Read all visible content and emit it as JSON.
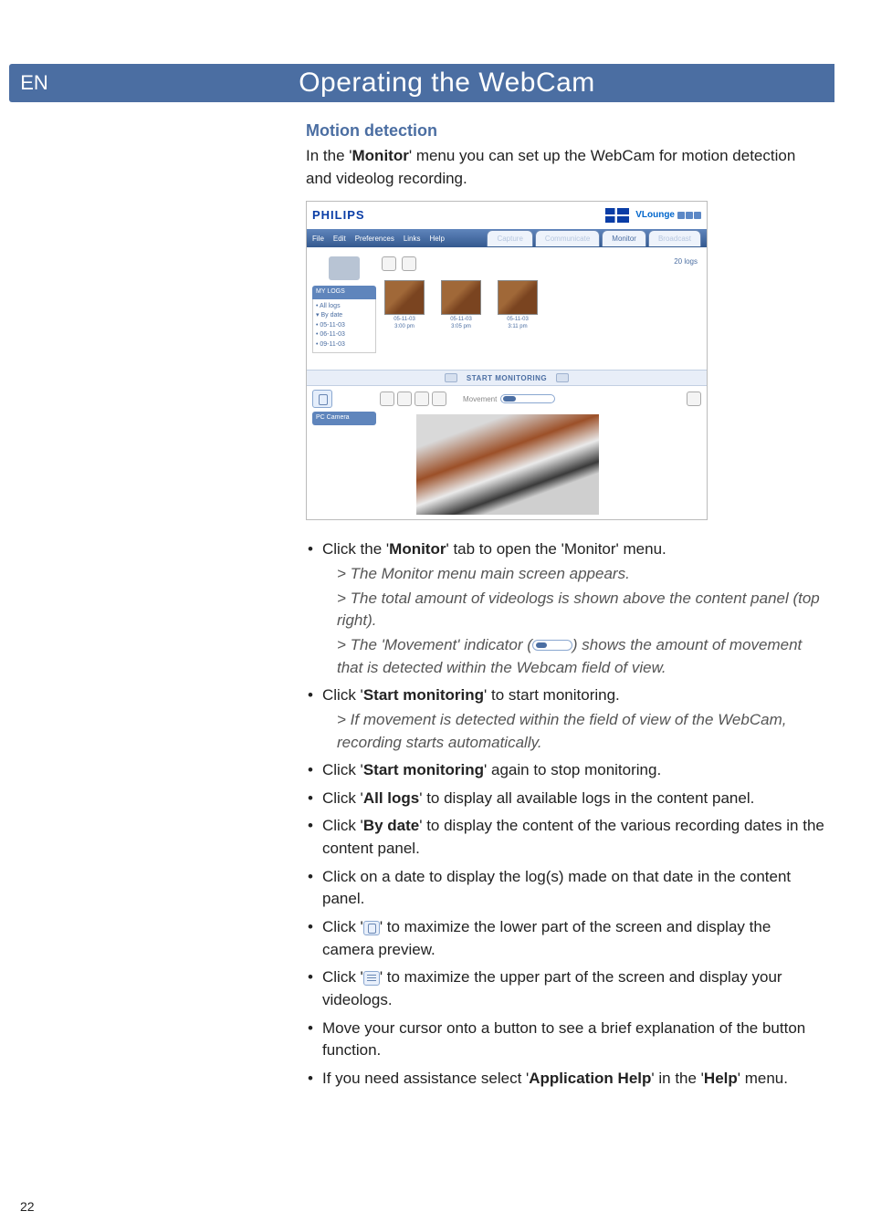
{
  "lang": "EN",
  "pageTitle": "Operating the WebCam",
  "h3": "Motion detection",
  "intro_pre": "In the '",
  "intro_bold": "Monitor",
  "intro_post": "' menu you can set up the WebCam for motion detection and videolog recording.",
  "screenshot": {
    "brand": "PHILIPS",
    "app": "VLounge",
    "menu": [
      "File",
      "Edit",
      "Preferences",
      "Links",
      "Help"
    ],
    "tabs": [
      "Capture",
      "Communicate",
      "Monitor",
      "Broadcast"
    ],
    "myLogs": "MY LOGS",
    "tree": [
      "• All logs",
      "▾ By date",
      "  • 05-11-03",
      "  • 06-11-03",
      "  • 09-11-03"
    ],
    "count": "20 logs",
    "thumbs": [
      {
        "d": "05-11-03",
        "t": "3:00 pm"
      },
      {
        "d": "05-11-03",
        "t": "3:05 pm"
      },
      {
        "d": "05-11-03",
        "t": "3:11 pm"
      }
    ],
    "startMon": "START MONITORING",
    "movement": "Movement",
    "pcCam": "PC Camera"
  },
  "bullets": {
    "b1_a": "Click the '",
    "b1_bold": "Monitor",
    "b1_b": "' tab to open the 'Monitor' menu.",
    "b1_s1": "The Monitor menu main screen appears.",
    "b1_s2": "The total amount of videologs is shown above the content panel (top right).",
    "b1_s3a": "The 'Movement' indicator (",
    "b1_s3b": ") shows the amount of movement that is detected within the Webcam field of view.",
    "b2_a": "Click '",
    "b2_bold": "Start monitoring",
    "b2_b": "' to start monitoring.",
    "b2_s1": "If movement is detected within the field of view of the WebCam, recording starts automatically.",
    "b3_a": "Click '",
    "b3_bold": "Start monitoring",
    "b3_b": "' again to stop monitoring.",
    "b4_a": "Click '",
    "b4_bold": "All logs",
    "b4_b": "' to display all available logs in the content panel.",
    "b5_a": "Click '",
    "b5_bold": "By date",
    "b5_b": "' to display the content of the various recording dates in the content panel.",
    "b6": "Click on a date to display the log(s) made on that date in the content panel.",
    "b7_a": "Click '",
    "b7_b": "' to maximize the lower part of the screen and display the camera preview.",
    "b8_a": "Click '",
    "b8_b": "' to maximize the upper part of the screen and display your videologs.",
    "b9": "Move your cursor onto a button to see a brief explanation of the button function.",
    "b10_a": "If you need assistance select '",
    "b10_bold": "Application Help",
    "b10_b": "' in the '",
    "b10_bold2": "Help",
    "b10_c": "' menu."
  },
  "pageNumber": "22"
}
